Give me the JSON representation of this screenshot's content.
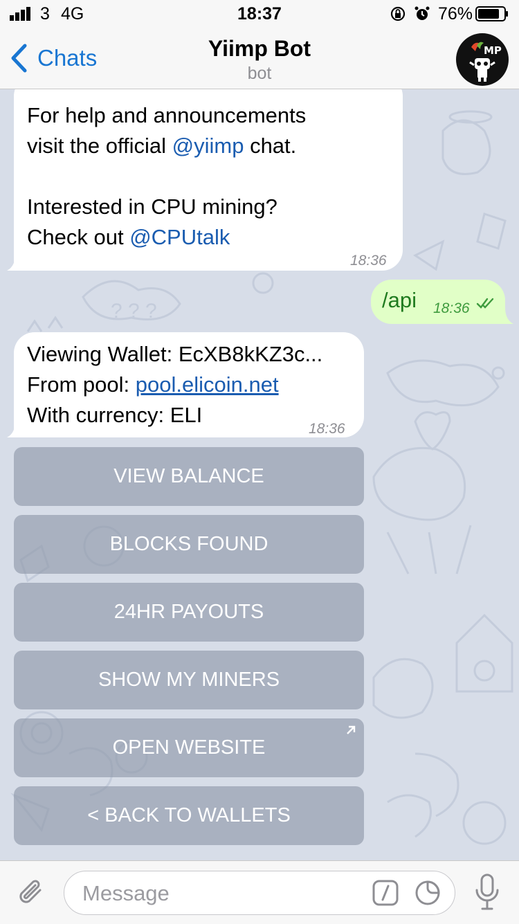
{
  "status_bar": {
    "carrier": "3",
    "network": "4G",
    "time": "18:37",
    "battery": "76%",
    "icons": [
      "signal-icon",
      "orientation-lock-icon",
      "alarm-icon",
      "battery-icon"
    ]
  },
  "nav": {
    "back_label": "Chats",
    "title": "Yiimp Bot",
    "subtitle": "bot",
    "avatar_text": "MP"
  },
  "messages": {
    "first": {
      "line1": "For help and announcements",
      "line2_pre": "visit the official ",
      "line2_link": "@yiimp",
      "line2_post": " chat.",
      "line3": "Interested in CPU mining?",
      "line4_pre": "Check out ",
      "line4_link": "@CPUtalk",
      "time": "18:36"
    },
    "outgoing": {
      "text": "/api",
      "time": "18:36"
    },
    "wallet": {
      "line1": "Viewing Wallet: EcXB8kKZ3c...",
      "line2_pre": "From pool: ",
      "line2_link": "pool.elicoin.net",
      "line3": "With currency: ELI",
      "time": "18:36"
    }
  },
  "keyboard": {
    "buttons": [
      "VIEW BALANCE",
      "BLOCKS FOUND",
      "24HR PAYOUTS",
      "SHOW MY MINERS",
      "OPEN WEBSITE",
      "< BACK TO WALLETS"
    ]
  },
  "input": {
    "placeholder": "Message"
  },
  "colors": {
    "accent": "#1976d2",
    "outgoing_bubble": "#e1ffc7",
    "chat_background": "#d7dde8"
  }
}
